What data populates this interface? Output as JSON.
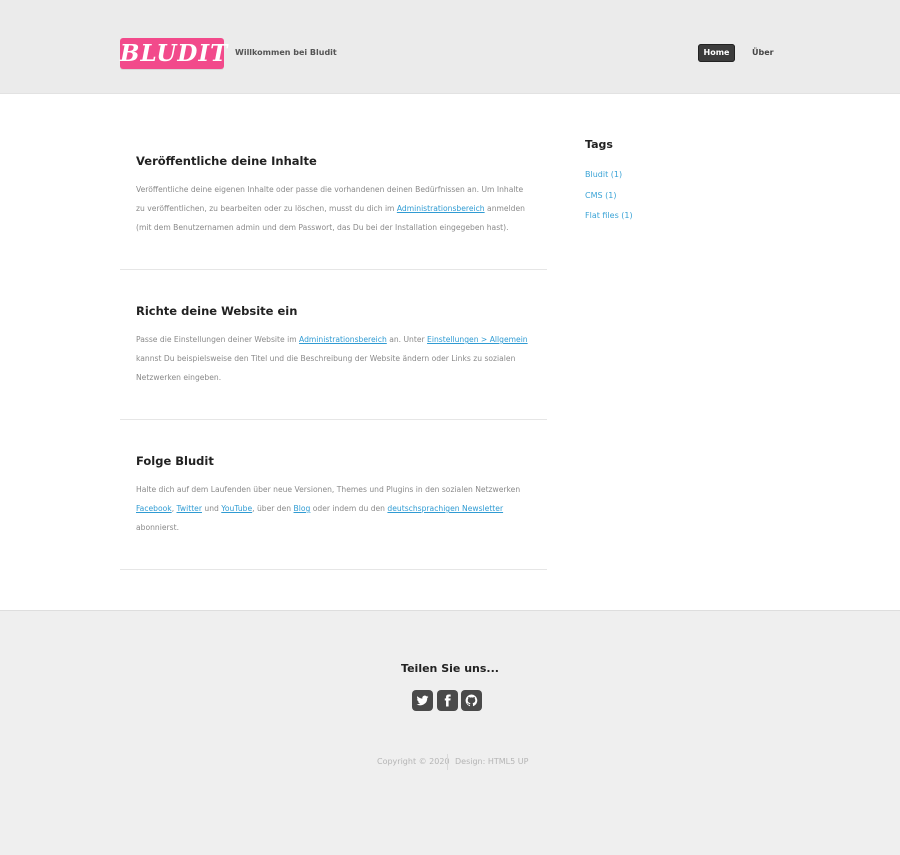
{
  "header": {
    "logo_text": "BLUDIT",
    "tagline": "Willkommen bei Bludit",
    "nav": [
      {
        "label": "Home"
      },
      {
        "label": "Über"
      }
    ]
  },
  "posts": [
    {
      "title": "Veröffentliche deine Inhalte",
      "text_1": "Veröffentliche deine eigenen Inhalte oder passe die vorhandenen deinen Bedürfnissen an. Um Inhalte zu veröffentlichen, zu bearbeiten oder zu löschen, musst du dich im ",
      "link_1": "Administrationsbereich",
      "text_2": " anmelden (mit dem Benutzernamen admin und dem Passwort, das Du bei der Installation eingegeben hast)."
    },
    {
      "title": "Richte deine Website ein",
      "text_1": "Passe die Einstellungen deiner Website im ",
      "link_1": "Administrationsbereich",
      "text_2": " an. Unter ",
      "link_2": "Einstellungen > Allgemein",
      "text_3": " kannst Du beispielsweise den Titel und die Beschreibung der Website ändern oder Links zu sozialen Netzwerken eingeben."
    },
    {
      "title": "Folge Bludit",
      "text_1": "Halte dich auf dem Laufenden über neue Versionen, Themes und Plugins in den sozialen Netzwerken ",
      "link_1": "Facebook",
      "text_2": ", ",
      "link_2": "Twitter",
      "text_3": " und ",
      "link_3": "YouTube",
      "text_4": ", über den ",
      "link_4": "Blog",
      "text_5": " oder indem du den ",
      "link_5": "deutschsprachigen Newsletter",
      "text_6": " abonnierst."
    }
  ],
  "sidebar": {
    "title": "Tags",
    "tags": [
      {
        "label": "Bludit (1)"
      },
      {
        "label": "CMS (1)"
      },
      {
        "label": "Flat files (1)"
      }
    ]
  },
  "footer": {
    "share_title": "Teilen Sie uns...",
    "social": [
      {
        "icon": "twitter-icon"
      },
      {
        "icon": "facebook-icon"
      },
      {
        "icon": "github-icon"
      }
    ],
    "copyright": "Copyright © 2020",
    "design": "Design: HTML5 UP"
  },
  "colors": {
    "logo_bg": "#f24a8b",
    "link": "#3aa3d6",
    "nav_active_bg": "#3c3c3c",
    "header_bg": "#ebebeb",
    "footer_bg": "#efefef"
  }
}
